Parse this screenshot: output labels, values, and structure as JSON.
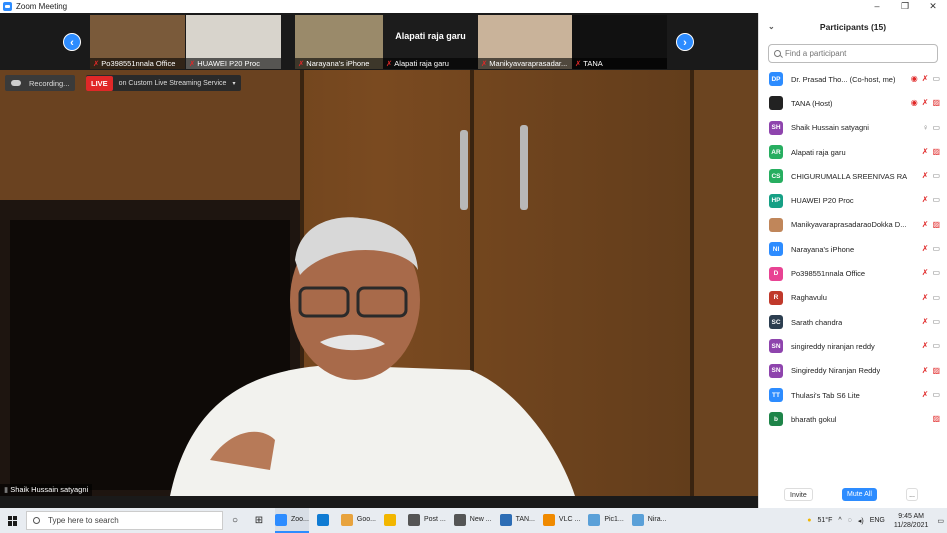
{
  "window": {
    "title": "Zoom Meeting",
    "controls": [
      "–",
      "❐",
      "✕"
    ]
  },
  "thumbnails": [
    {
      "name": "Po398551nnala Office",
      "muted": true,
      "bg": "#7a5a3a"
    },
    {
      "name": "HUAWEI P20 Proc",
      "muted": true,
      "bg": "#d8d4cc"
    },
    {
      "name": "Narayana's iPhone",
      "muted": true,
      "bg": "#9a8a6a"
    },
    {
      "name": "Alapati raja garu",
      "muted": true,
      "bg": "#1c1c1c",
      "bigname": "Alapati raja garu"
    },
    {
      "name": "Manikyavaraprasadar...",
      "muted": true,
      "bg": "#c9b39a"
    },
    {
      "name": "TANA",
      "muted": true,
      "bg": "#111111"
    }
  ],
  "status": {
    "recording": "Recording...",
    "live_tag": "LIVE",
    "live_text": "on Custom Live Streaming Service",
    "live_caret": "▾"
  },
  "active_speaker": "Shaik Hussain satyagni",
  "panel": {
    "title": "Participants (15)",
    "search_placeholder": "Find a participant",
    "participants": [
      {
        "initials": "DP",
        "color": "#2d8cff",
        "name": "Dr. Prasad Tho... (Co-host, me)",
        "icons": [
          "share-icon",
          "mic-off-icon",
          "video-icon"
        ]
      },
      {
        "initials": "",
        "color": "#222222",
        "name": "TANA (Host)",
        "icons": [
          "share-icon",
          "mic-off-icon",
          "video-off-icon"
        ]
      },
      {
        "initials": "SH",
        "color": "#8e44ad",
        "name": "Shaik Hussain satyagni",
        "icons": [
          "mic-icon",
          "video-icon"
        ]
      },
      {
        "initials": "AR",
        "color": "#27ae60",
        "name": "Alapati raja garu",
        "icons": [
          "mic-off-icon",
          "video-off-icon"
        ]
      },
      {
        "initials": "CS",
        "color": "#27ae60",
        "name": "CHIGURUMALLA SREENIVAS RAO",
        "icons": [
          "mic-off-icon",
          "video-icon"
        ]
      },
      {
        "initials": "HP",
        "color": "#16a085",
        "name": "HUAWEI P20 Proc",
        "icons": [
          "mic-off-icon",
          "video-icon"
        ]
      },
      {
        "initials": "",
        "color": "#c0865a",
        "name": "ManikyavaraprasadaraoDokka D...",
        "icons": [
          "mic-off-icon",
          "video-off-icon"
        ]
      },
      {
        "initials": "NI",
        "color": "#2d8cff",
        "name": "Narayana's iPhone",
        "icons": [
          "mic-off-icon",
          "video-icon"
        ]
      },
      {
        "initials": "D",
        "color": "#e84393",
        "name": "Po398551nnala Office",
        "icons": [
          "mic-off-icon",
          "video-icon"
        ]
      },
      {
        "initials": "R",
        "color": "#c0392b",
        "name": "Raghavulu",
        "icons": [
          "mic-off-icon",
          "video-icon"
        ]
      },
      {
        "initials": "SC",
        "color": "#2c3e50",
        "name": "Sarath chandra",
        "icons": [
          "mic-off-icon",
          "video-icon"
        ]
      },
      {
        "initials": "SN",
        "color": "#8e44ad",
        "name": "singireddy niranjan reddy",
        "icons": [
          "mic-off-icon",
          "video-icon"
        ]
      },
      {
        "initials": "SN",
        "color": "#8e44ad",
        "name": "Singireddy Niranjan Reddy",
        "icons": [
          "mic-off-icon",
          "video-off-icon"
        ]
      },
      {
        "initials": "TT",
        "color": "#2d8cff",
        "name": "Thulasi's Tab S6 Lite",
        "icons": [
          "mic-off-icon",
          "video-icon"
        ]
      },
      {
        "initials": "b",
        "color": "#1e8449",
        "name": "bharath gokul",
        "icons": [
          "video-off-icon"
        ]
      }
    ],
    "invite_label": "Invite",
    "mute_all_label": "Mute All",
    "more_label": "..."
  },
  "taskbar": {
    "search_placeholder": "Type here to search",
    "apps": [
      {
        "label": "Zoo...",
        "color": "#2d8cff",
        "active": true
      },
      {
        "label": "",
        "color": "#0f7bd3",
        "active": false
      },
      {
        "label": "Goo...",
        "color": "#e8a33d",
        "active": false
      },
      {
        "label": "",
        "color": "#f2b600",
        "active": false
      },
      {
        "label": "Post ...",
        "color": "#555555",
        "active": false
      },
      {
        "label": "New ...",
        "color": "#555555",
        "active": false
      },
      {
        "label": "TAN...",
        "color": "#2d6db5",
        "active": false
      },
      {
        "label": "VLC ...",
        "color": "#f08a00",
        "active": false
      },
      {
        "label": "Pic1...",
        "color": "#5aa0d8",
        "active": false
      },
      {
        "label": "Nira...",
        "color": "#5aa0d8",
        "active": false
      }
    ],
    "weather": "51°F",
    "lang": "ENG",
    "time": "9:45 AM",
    "date": "11/28/2021"
  }
}
